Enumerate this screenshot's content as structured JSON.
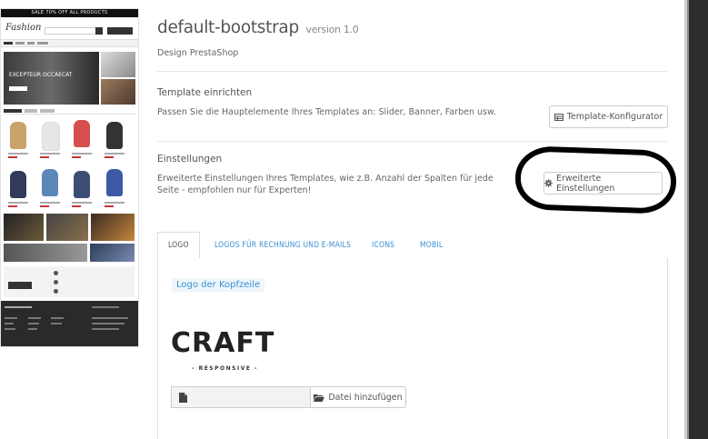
{
  "theme": {
    "title": "default-bootstrap",
    "version": "version 1.0",
    "designer": "Design PrestaShop"
  },
  "thumbnail": {
    "promo_bar": "SALE 70% OFF ALL PRODUCTS",
    "logo": "Fashion",
    "hero_text": "EXCEPTEUR OCCAECAT"
  },
  "section_template": {
    "heading": "Template einrichten",
    "description": "Passen Sie die Hauptelemente Ihres Templates an: Slider, Banner, Farben usw.",
    "button_label": "Template-Konfigurator",
    "button_icon": "table-icon"
  },
  "section_settings": {
    "heading": "Einstellungen",
    "description_line1": "Erweiterte Einstellungen Ihres Templates, wie z.B. Anzahl der Spalten für jede",
    "description_line2": "Seite - empfohlen nur für Experten!",
    "button_label": "Erweiterte Einstellungen",
    "button_icon": "gear-icon"
  },
  "tabs": [
    {
      "label": "LOGO",
      "active": true
    },
    {
      "label": "LOGOS FÜR RECHNUNG UND E-MAILS",
      "active": false
    },
    {
      "label": "ICONS",
      "active": false
    },
    {
      "label": "MOBIL",
      "active": false
    }
  ],
  "logo_panel": {
    "label": "Logo der Kopfzeile",
    "logo_text": "CRAFT",
    "logo_subtext": "- RESPONSIVE -",
    "file_input_value": "",
    "add_file_label": "Datei hinzufügen",
    "file_icon": "file-icon",
    "folder_icon": "folder-open-icon"
  },
  "colors": {
    "accent": "#3a8fd0",
    "annotation": "#000000"
  }
}
